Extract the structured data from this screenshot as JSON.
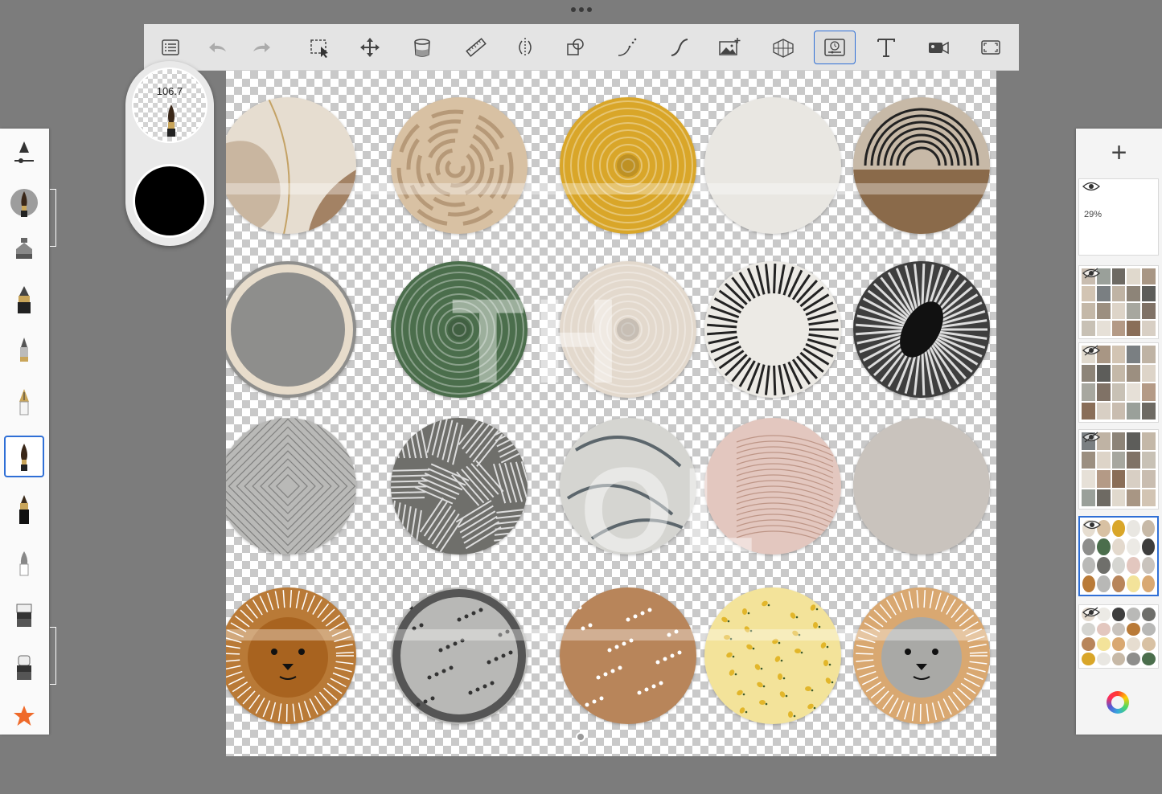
{
  "toolbar": {
    "tools": [
      {
        "name": "layers-list",
        "icon": "list-icon"
      },
      {
        "name": "undo",
        "icon": "undo-icon"
      },
      {
        "name": "redo",
        "icon": "redo-icon"
      },
      {
        "name": "selection",
        "icon": "selection-icon"
      },
      {
        "name": "transform",
        "icon": "move-icon"
      },
      {
        "name": "fill",
        "icon": "paint-bucket-icon"
      },
      {
        "name": "ruler",
        "icon": "ruler-icon"
      },
      {
        "name": "symmetry",
        "icon": "symmetry-icon"
      },
      {
        "name": "shapes",
        "icon": "shapes-icon"
      },
      {
        "name": "stroke",
        "icon": "stroke-icon"
      },
      {
        "name": "curve",
        "icon": "curve-icon"
      },
      {
        "name": "import-image",
        "icon": "image-add-icon"
      },
      {
        "name": "perspective",
        "icon": "perspective-grid-icon"
      },
      {
        "name": "time-lapse",
        "icon": "time-lapse-icon"
      },
      {
        "name": "text",
        "icon": "text-icon",
        "label": "T"
      },
      {
        "name": "record",
        "icon": "video-icon"
      },
      {
        "name": "fullscreen",
        "icon": "fullscreen-icon"
      }
    ],
    "active_tool": "time-lapse",
    "accent_color": "#2f6fd6"
  },
  "brush_puck": {
    "size": "106.7",
    "color": "#000000"
  },
  "watermark": {
    "text_line1": "TH",
    "text_line2": "OL"
  },
  "brushes": [
    {
      "name": "brush-settings",
      "icon": "brush-settings-icon"
    },
    {
      "name": "paint-brush",
      "icon": "paint-brush-icon"
    },
    {
      "name": "airbrush",
      "icon": "airbrush-icon"
    },
    {
      "name": "ink-pen",
      "icon": "ink-pen-icon"
    },
    {
      "name": "pencil",
      "icon": "pencil-icon"
    },
    {
      "name": "fountain-pen",
      "icon": "fountain-pen-icon"
    },
    {
      "name": "round-brush",
      "icon": "round-brush-icon",
      "selected": true
    },
    {
      "name": "marker",
      "icon": "marker-icon"
    },
    {
      "name": "smudge",
      "icon": "smudge-icon"
    },
    {
      "name": "eraser-hard",
      "icon": "eraser-icon"
    },
    {
      "name": "eraser-soft",
      "icon": "soft-eraser-icon"
    },
    {
      "name": "favorites",
      "icon": "star-icon"
    }
  ],
  "plates": [
    {
      "bg": "#e6ddd0",
      "pattern": "abstract"
    },
    {
      "bg": "#d8c1a3",
      "pattern": "swirl"
    },
    {
      "bg": "#d9a629",
      "pattern": "rings"
    },
    {
      "bg": "#e9e7e2",
      "pattern": "plain"
    },
    {
      "bg": "#c7b9a7",
      "pattern": "arches"
    },
    {
      "bg": "#8e8e8c",
      "pattern": "border"
    },
    {
      "bg": "#4b6e4c",
      "pattern": "rings"
    },
    {
      "bg": "#e3d9cd",
      "pattern": "rings"
    },
    {
      "bg": "#eceae5",
      "pattern": "rays"
    },
    {
      "bg": "#3e3e3e",
      "pattern": "rays-dark"
    },
    {
      "bg": "#b9b9b7",
      "pattern": "diamond"
    },
    {
      "bg": "#6f6f6b",
      "pattern": "hatch"
    },
    {
      "bg": "#d5d5d1",
      "pattern": "waves"
    },
    {
      "bg": "#e3c7bf",
      "pattern": "lines"
    },
    {
      "bg": "#c9c3bd",
      "pattern": "plain"
    },
    {
      "bg": "#b97a37",
      "pattern": "lion"
    },
    {
      "bg": "#b8b8b6",
      "pattern": "dots-dark"
    },
    {
      "bg": "#b8855a",
      "pattern": "dots-white"
    },
    {
      "bg": "#f3e39a",
      "pattern": "lemons"
    },
    {
      "bg": "#d9a871",
      "pattern": "cat"
    }
  ],
  "layers": {
    "add_label": "+",
    "items": [
      {
        "name": "layer-1",
        "opacity": "29%",
        "visible": true,
        "selected": false,
        "thumb": "empty"
      },
      {
        "name": "layer-2",
        "visible": false,
        "selected": false,
        "thumb": "textures-a"
      },
      {
        "name": "layer-3",
        "visible": false,
        "selected": false,
        "thumb": "textures-b"
      },
      {
        "name": "layer-4",
        "visible": false,
        "selected": false,
        "thumb": "textures-c"
      },
      {
        "name": "layer-5",
        "visible": true,
        "selected": true,
        "thumb": "plates"
      },
      {
        "name": "layer-6",
        "visible": false,
        "selected": false,
        "thumb": "plates-b"
      }
    ]
  }
}
